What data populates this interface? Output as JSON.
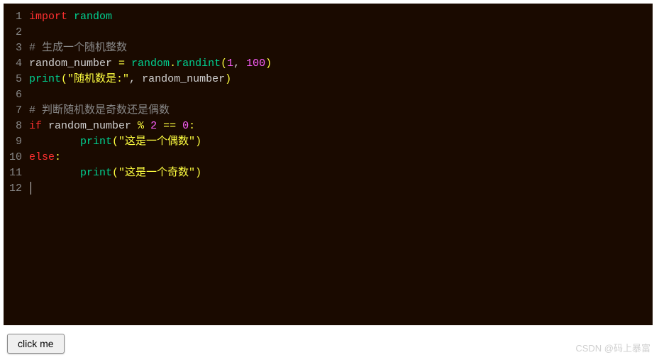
{
  "code": {
    "lines": [
      {
        "n": "1",
        "tokens": [
          {
            "t": "import ",
            "c": "kw"
          },
          {
            "t": "random",
            "c": "mod"
          }
        ]
      },
      {
        "n": "2",
        "tokens": []
      },
      {
        "n": "3",
        "tokens": [
          {
            "t": "# 生成一个随机整数",
            "c": "comment"
          }
        ]
      },
      {
        "n": "4",
        "tokens": [
          {
            "t": "random_number ",
            "c": "id"
          },
          {
            "t": "= ",
            "c": "op"
          },
          {
            "t": "random",
            "c": "mod"
          },
          {
            "t": ".",
            "c": "op"
          },
          {
            "t": "randint",
            "c": "fn"
          },
          {
            "t": "(",
            "c": "paren"
          },
          {
            "t": "1",
            "c": "num"
          },
          {
            "t": ", ",
            "c": "comma"
          },
          {
            "t": "100",
            "c": "num"
          },
          {
            "t": ")",
            "c": "paren"
          }
        ]
      },
      {
        "n": "5",
        "tokens": [
          {
            "t": "print",
            "c": "fn"
          },
          {
            "t": "(",
            "c": "paren"
          },
          {
            "t": "\"随机数是:\"",
            "c": "str"
          },
          {
            "t": ", ",
            "c": "comma"
          },
          {
            "t": "random_number",
            "c": "id"
          },
          {
            "t": ")",
            "c": "paren"
          }
        ]
      },
      {
        "n": "6",
        "tokens": []
      },
      {
        "n": "7",
        "tokens": [
          {
            "t": "# 判断随机数是奇数还是偶数",
            "c": "comment"
          }
        ]
      },
      {
        "n": "8",
        "tokens": [
          {
            "t": "if ",
            "c": "kw"
          },
          {
            "t": "random_number ",
            "c": "id"
          },
          {
            "t": "% ",
            "c": "op"
          },
          {
            "t": "2",
            "c": "num"
          },
          {
            "t": " == ",
            "c": "op"
          },
          {
            "t": "0",
            "c": "num"
          },
          {
            "t": ":",
            "c": "op"
          }
        ]
      },
      {
        "n": "9",
        "tokens": [
          {
            "t": "        ",
            "c": "id"
          },
          {
            "t": "print",
            "c": "fn"
          },
          {
            "t": "(",
            "c": "paren"
          },
          {
            "t": "\"这是一个偶数\"",
            "c": "str"
          },
          {
            "t": ")",
            "c": "paren"
          }
        ]
      },
      {
        "n": "10",
        "tokens": [
          {
            "t": "else",
            "c": "kw"
          },
          {
            "t": ":",
            "c": "op"
          }
        ]
      },
      {
        "n": "11",
        "tokens": [
          {
            "t": "        ",
            "c": "id"
          },
          {
            "t": "print",
            "c": "fn"
          },
          {
            "t": "(",
            "c": "paren"
          },
          {
            "t": "\"这是一个奇数\"",
            "c": "str"
          },
          {
            "t": ")",
            "c": "paren"
          }
        ]
      },
      {
        "n": "12",
        "tokens": [],
        "cursor": true
      }
    ]
  },
  "button": {
    "label": "click me"
  },
  "watermark": "CSDN @码上暴富"
}
